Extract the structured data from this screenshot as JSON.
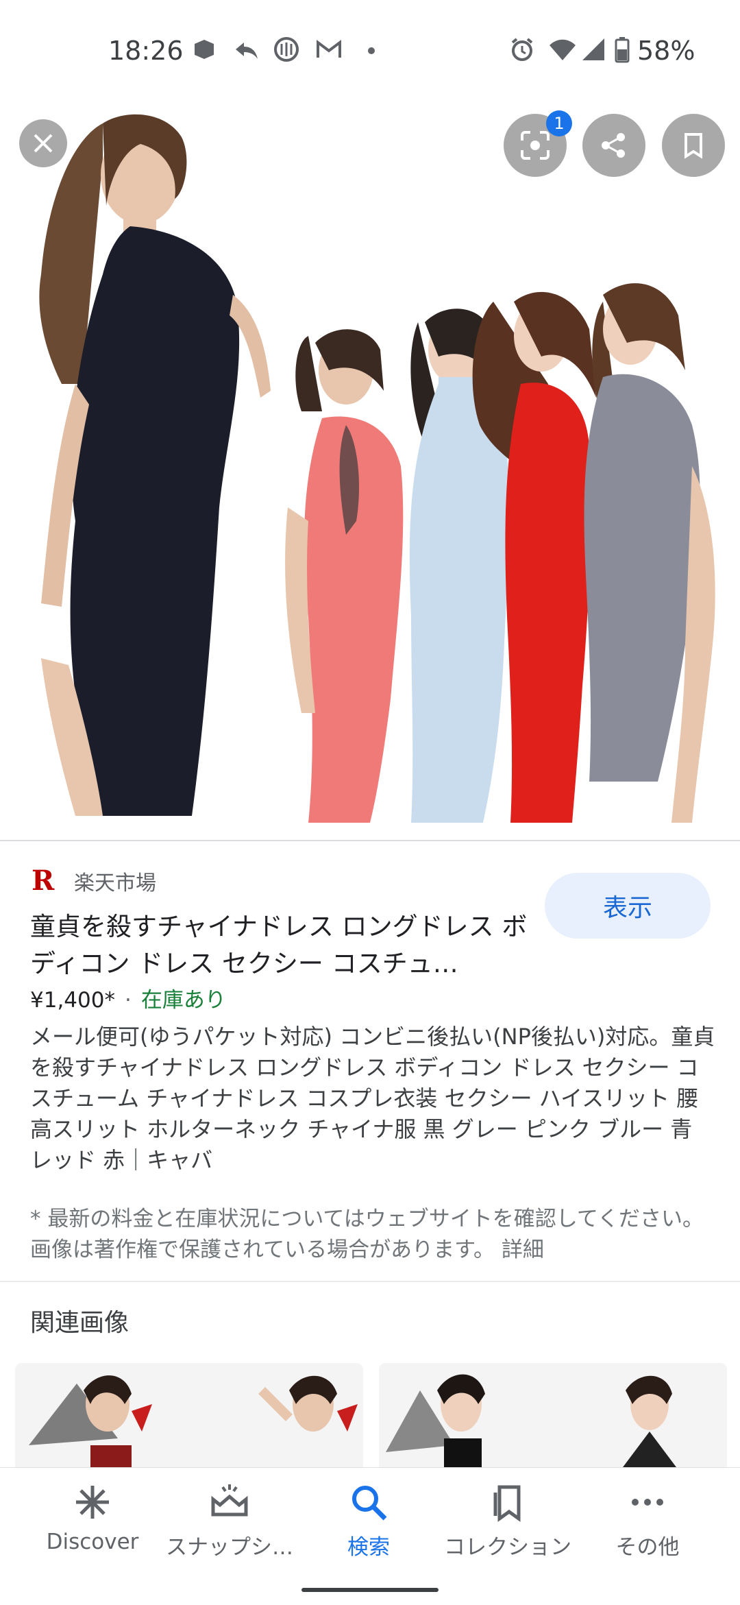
{
  "status_bar": {
    "time": "18:26",
    "battery_percent": "58%",
    "icons": [
      "notification-app-icon",
      "reply-icon",
      "meeting-app-icon",
      "gmail-icon",
      "dot-icon",
      "alarm-icon",
      "wifi-icon",
      "signal-icon",
      "battery-icon"
    ]
  },
  "image_viewer": {
    "lens_badge_count": "1",
    "buttons": [
      "close-icon",
      "lens-icon",
      "share-icon",
      "bookmark-icon"
    ]
  },
  "result": {
    "source_logo": "R",
    "source_name": "楽天市場",
    "view_button": "表示",
    "title": "童貞を殺すチャイナドレス ロングドレス ボディコン ドレス セクシー コスチュ…",
    "price": "¥1,400*",
    "separator": "·",
    "stock": "在庫あり",
    "description": "メール便可(ゆうパケット対応) コンビニ後払い(NP後払い)対応。童貞を殺すチャイナドレス ロングドレス ボディコン ドレス セクシー コスチューム チャイナドレス コスプレ衣装 セクシー ハイスリット 腰高スリット ホルターネック チャイナ服 黒 グレー ピンク ブルー 青 レッド 赤｜キャバ",
    "note": "* 最新の料金と在庫状況についてはウェブサイトを確認してください。 画像は著作権で保護されている場合があります。 詳細"
  },
  "related": {
    "title": "関連画像"
  },
  "bottom_nav": {
    "items": [
      {
        "label": "Discover",
        "icon": "discover-icon"
      },
      {
        "label": "スナップシ…",
        "icon": "snapshot-icon"
      },
      {
        "label": "検索",
        "icon": "search-icon"
      },
      {
        "label": "コレクション",
        "icon": "collections-icon"
      },
      {
        "label": "その他",
        "icon": "more-icon"
      }
    ],
    "active": "検索"
  },
  "colors": {
    "accent": "#1a73e8",
    "stock_green": "#188038",
    "rakuten_red": "#bf0000"
  }
}
